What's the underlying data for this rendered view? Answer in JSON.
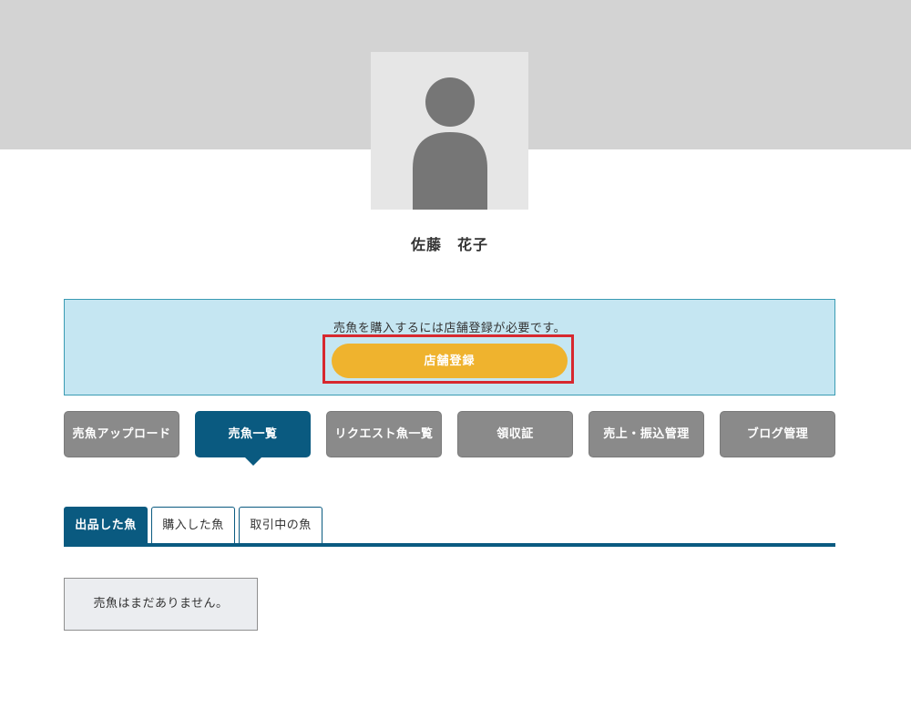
{
  "profile": {
    "name": "佐藤　花子",
    "avatar_icon": "person-silhouette-icon"
  },
  "notice": {
    "message": "売魚を購入するには店舗登録が必要です。",
    "register_button_label": "店舗登録"
  },
  "nav": {
    "items": [
      {
        "label": "売魚アップロード",
        "active": false
      },
      {
        "label": "売魚一覧",
        "active": true
      },
      {
        "label": "リクエスト魚一覧",
        "active": false
      },
      {
        "label": "領収証",
        "active": false
      },
      {
        "label": "売上・振込管理",
        "active": false
      },
      {
        "label": "ブログ管理",
        "active": false
      }
    ]
  },
  "tabs": {
    "items": [
      {
        "label": "出品した魚",
        "active": true
      },
      {
        "label": "購入した魚",
        "active": false
      },
      {
        "label": "取引中の魚",
        "active": false
      }
    ]
  },
  "content": {
    "empty_message": "売魚はまだありません。"
  },
  "colors": {
    "primary": "#0a5a80",
    "accent_button": "#efb32e",
    "notice_background": "#c5e6f2",
    "highlight": "#d7282f",
    "nav_inactive": "#8a8a8a"
  }
}
